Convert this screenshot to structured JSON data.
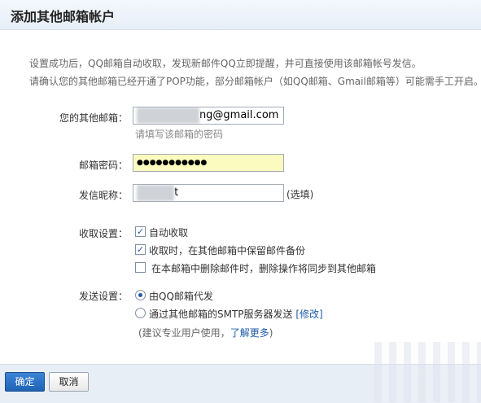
{
  "window": {
    "title": "添加其他邮箱帐户"
  },
  "description": {
    "line1": "设置成功后，QQ邮箱自动收取，发现新邮件QQ立即提醒，并可直接使用该邮箱帐号发信。",
    "line2": "请确认您的其他邮箱已经开通了POP功能，部分邮箱帐户（如QQ邮箱、Gmail邮箱等）可能需手工开启。"
  },
  "form": {
    "email": {
      "label": "您的其他邮箱：",
      "value_suffix": "ng@gmail.com",
      "hint": "请填写该邮箱的密码"
    },
    "password": {
      "label": "邮箱密码：",
      "value": "●●●●●●●●●●●"
    },
    "nickname": {
      "label": "发信昵称：",
      "value_suffix": "t",
      "optional": "(选填)"
    },
    "receive": {
      "label": "收取设置：",
      "options": [
        {
          "label": "自动收取",
          "checked": true
        },
        {
          "label": "收取时，在其他邮箱中保留邮件备份",
          "checked": true
        },
        {
          "label": "在本邮箱中删除邮件时，删除操作将同步到其他邮箱",
          "checked": false
        }
      ]
    },
    "send": {
      "label": "发送设置：",
      "options": [
        {
          "label": "由QQ邮箱代发",
          "selected": true
        },
        {
          "label": "通过其他邮箱的SMTP服务器发送",
          "selected": false
        }
      ],
      "modify_link": "[修改]",
      "advice_prefix": "(建议专业用户使用，",
      "learn_more": "了解更多",
      "advice_suffix": ")"
    }
  },
  "buttons": {
    "confirm": "确定",
    "cancel": "取消"
  },
  "colors": {
    "accent": "#1e5aa8",
    "password_bg": "#fbfbbf",
    "footer_bg": "#e8eef6"
  }
}
